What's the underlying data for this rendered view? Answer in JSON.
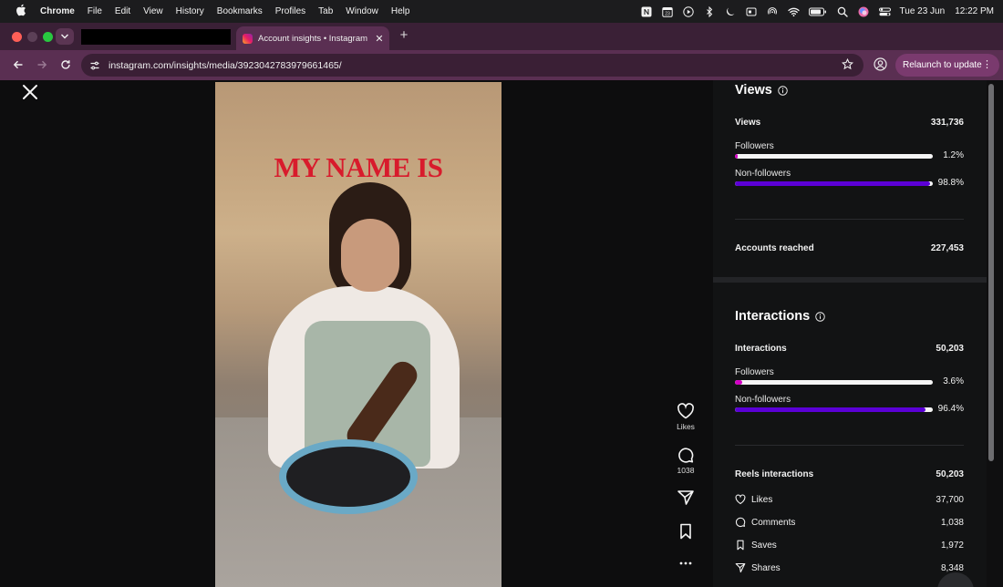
{
  "menubar": {
    "app": "Chrome",
    "items": [
      "File",
      "Edit",
      "View",
      "History",
      "Bookmarks",
      "Profiles",
      "Tab",
      "Window",
      "Help"
    ],
    "status_icons": [
      "notion-icon",
      "calendar-icon",
      "play-circle-icon",
      "bluetooth-icon",
      "moon-icon",
      "display-icon",
      "airdrop-icon",
      "wifi-icon",
      "battery-icon",
      "search-icon",
      "siri-icon",
      "control-center-icon"
    ],
    "date": "Tue 23 Jun",
    "time": "12:22 PM"
  },
  "browser": {
    "tab_title": "Account insights • Instagram",
    "url": "instagram.com/insights/media/3923042783979661465/",
    "relaunch_label": "Relaunch to update"
  },
  "video": {
    "overlay_text": "MY NAME IS"
  },
  "reel_actions": {
    "likes_label": "Likes",
    "comments_count": "1038"
  },
  "insights": {
    "views": {
      "title": "Views",
      "total_label": "Views",
      "total_value": "331,736",
      "followers_label": "Followers",
      "followers_pct": "1.2%",
      "followers_fraction": 0.012,
      "nonfollowers_label": "Non-followers",
      "nonfollowers_pct": "98.8%",
      "nonfollowers_fraction": 0.988,
      "reached_label": "Accounts reached",
      "reached_value": "227,453"
    },
    "interactions": {
      "title": "Interactions",
      "total_label": "Interactions",
      "total_value": "50,203",
      "followers_label": "Followers",
      "followers_pct": "3.6%",
      "followers_fraction": 0.036,
      "nonfollowers_label": "Non-followers",
      "nonfollowers_pct": "96.4%",
      "nonfollowers_fraction": 0.964,
      "reels_label": "Reels interactions",
      "reels_value": "50,203",
      "likes_label": "Likes",
      "likes_value": "37,700",
      "comments_label": "Comments",
      "comments_value": "1,038",
      "saves_label": "Saves",
      "saves_value": "1,972",
      "shares_label": "Shares",
      "shares_value": "8,348"
    }
  },
  "colors": {
    "followers_bar": "#d300c5",
    "nonfollowers_bar": "#5b00d6",
    "tab_strip": "#3a2036",
    "toolbar": "#5a2f52"
  }
}
